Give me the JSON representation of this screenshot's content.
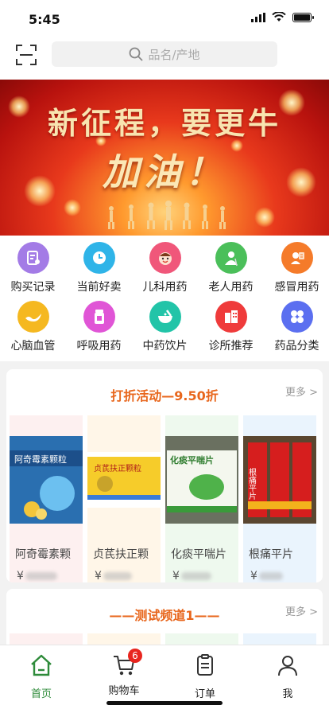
{
  "status_bar": {
    "time": "5:45"
  },
  "search": {
    "placeholder": "品名/产地"
  },
  "banner": {
    "title": "新征程，要更牛",
    "subtitle": "加油！"
  },
  "categories": [
    {
      "label": "购买记录",
      "icon": "record-icon",
      "color": "#a37be6"
    },
    {
      "label": "当前好卖",
      "icon": "clock-icon",
      "color": "#2fb4e8"
    },
    {
      "label": "儿科用药",
      "icon": "child-face-icon",
      "color": "#f0577a"
    },
    {
      "label": "老人用药",
      "icon": "elder-icon",
      "color": "#4bbf5a"
    },
    {
      "label": "感冒用药",
      "icon": "cold-icon",
      "color": "#f57b2a"
    },
    {
      "label": "心脑血管",
      "icon": "heart-brain-icon",
      "color": "#f5b820"
    },
    {
      "label": "呼吸用药",
      "icon": "inhaler-icon",
      "color": "#e055d6"
    },
    {
      "label": "中药饮片",
      "icon": "mortar-icon",
      "color": "#22c4a8"
    },
    {
      "label": "诊所推荐",
      "icon": "clinic-icon",
      "color": "#ef3b3b"
    },
    {
      "label": "药品分类",
      "icon": "grid-icon",
      "color": "#5b6ff0"
    }
  ],
  "section1": {
    "title": "打折活动—9.50折",
    "more": "更多 >",
    "products": [
      {
        "name": "阿奇霉素颗",
        "price_prefix": "¥",
        "bg": "#fdf0f0",
        "pkg": "阿奇霉素颗粒"
      },
      {
        "name": "贞芪扶正颗",
        "price_prefix": "¥",
        "bg": "#fff6e8",
        "pkg": "贞芪扶正颗粒"
      },
      {
        "name": "化痰平喘片",
        "price_prefix": "¥",
        "bg": "#eef9ee",
        "pkg": "化痰平喘片"
      },
      {
        "name": "根痛平片",
        "price_prefix": "¥",
        "bg": "#eaf4fd",
        "pkg": "根痛平片"
      }
    ]
  },
  "section2": {
    "title": "——测试频道1——",
    "more": "更多 >"
  },
  "tabbar": {
    "tabs": [
      {
        "label": "首页"
      },
      {
        "label": "购物车"
      },
      {
        "label": "订单"
      },
      {
        "label": "我"
      }
    ],
    "cart_badge": "6"
  },
  "colors": {
    "accent_green": "#2e8b3a",
    "section_title": "#e8661c",
    "badge_red": "#e8251e"
  }
}
